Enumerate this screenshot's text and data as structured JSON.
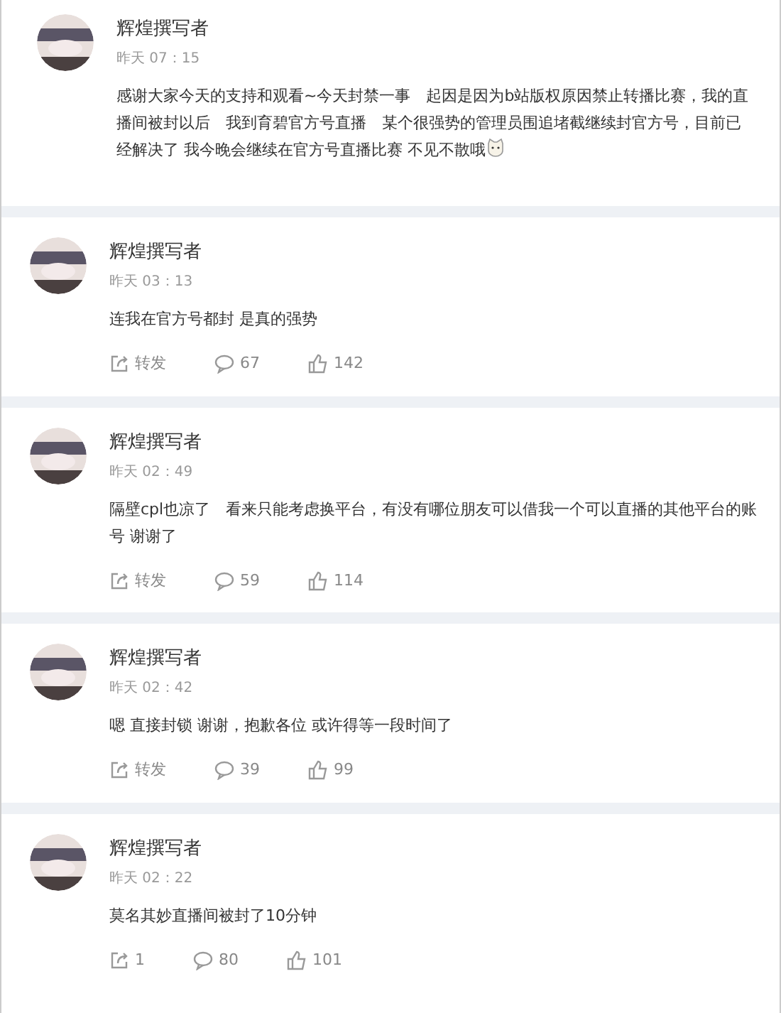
{
  "posts": [
    {
      "author": "辉煌撰写者",
      "time": "昨天 07：15",
      "text": "感谢大家今天的支持和观看~今天封禁一事　起因是因为b站版权原因禁止转播比赛，我的直播间被封以后　我到育碧官方号直播　某个很强势的管理员围追堵截继续封官方号，目前已经解决了 我今晚会继续在官方号直播比赛 不见不散哦",
      "emoji": true
    },
    {
      "author": "辉煌撰写者",
      "time": "昨天 03：13",
      "text": "连我在官方号都封 是真的强势",
      "actions": {
        "repost": "转发",
        "comments": "67",
        "likes": "142"
      }
    },
    {
      "author": "辉煌撰写者",
      "time": "昨天 02：49",
      "text": "隔壁cpl也凉了　看来只能考虑换平台，有没有哪位朋友可以借我一个可以直播的其他平台的账号 谢谢了",
      "actions": {
        "repost": "转发",
        "comments": "59",
        "likes": "114"
      }
    },
    {
      "author": "辉煌撰写者",
      "time": "昨天 02：42",
      "text": "嗯 直接封锁 谢谢，抱歉各位 或许得等一段时间了",
      "actions": {
        "repost": "转发",
        "comments": "39",
        "likes": "99"
      }
    },
    {
      "author": "辉煌撰写者",
      "time": "昨天 02：22",
      "text": "莫名其妙直播间被封了10分钟",
      "actions": {
        "repost": "1",
        "comments": "80",
        "likes": "101"
      }
    }
  ]
}
